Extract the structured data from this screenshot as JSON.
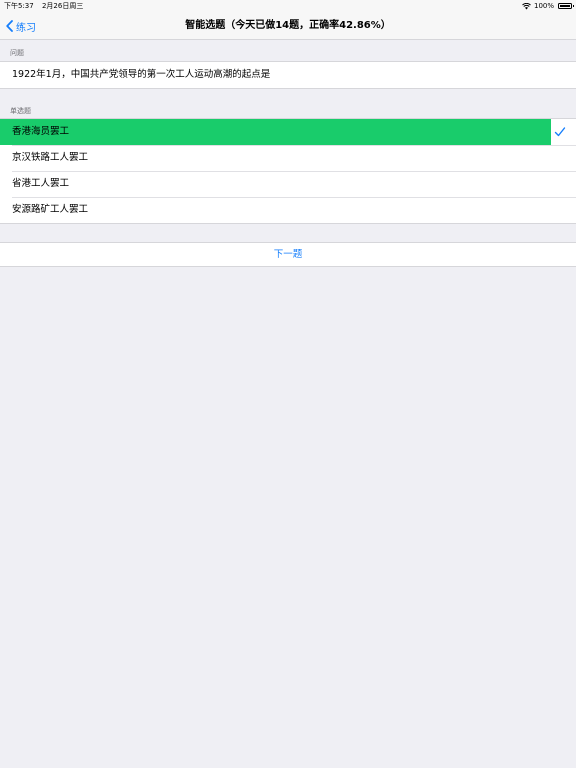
{
  "status_bar": {
    "time": "下午5:37",
    "date": "2月26日周三",
    "battery": "100%"
  },
  "nav": {
    "back_label": "练习",
    "title": "智能选题（今天已做14题，正确率42.86%）"
  },
  "question_section": {
    "header": "问题",
    "text": "1922年1月，中国共产党领导的第一次工人运动高潮的起点是"
  },
  "options_section": {
    "header": "单选题",
    "options": [
      {
        "label": "香港海员罢工",
        "selected": true
      },
      {
        "label": "京汉铁路工人罢工",
        "selected": false
      },
      {
        "label": "省港工人罢工",
        "selected": false
      },
      {
        "label": "安源路矿工人罢工",
        "selected": false
      }
    ]
  },
  "next_button": {
    "label": "下一题"
  },
  "colors": {
    "accent": "#157efb",
    "selected_bg": "#19cc6b",
    "background": "#efeff4"
  }
}
